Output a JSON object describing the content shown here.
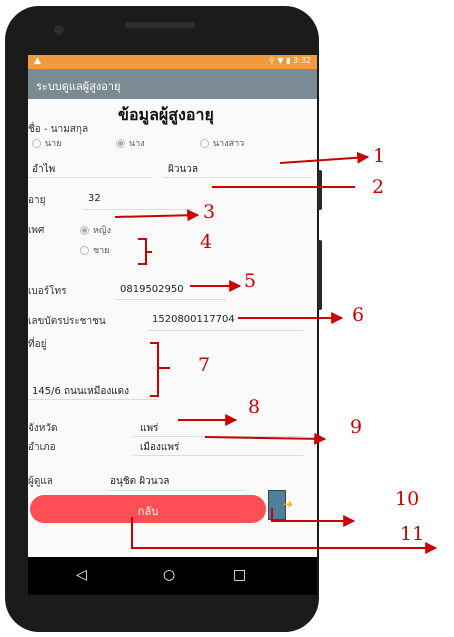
{
  "status_bar": {
    "warning_icon": "warning-icon",
    "indicators": "⚲ ▼ ▮",
    "time": "3:32",
    "color": "#f09a3c"
  },
  "app_bar": {
    "title": "ระบบดูแลผู้สูงอายุ",
    "color": "#7b8a93"
  },
  "page": {
    "title": "ข้อมูลผู้สูงอายุ"
  },
  "name_section": {
    "label": "ชื่อ - นามสกุล",
    "prefix_options": [
      "นาย",
      "นาง",
      "นางสาว"
    ],
    "selected_prefix": "นาง",
    "first_name": "อำไพ",
    "last_name": "ผิวนวล"
  },
  "age": {
    "label": "อายุ",
    "value": "32"
  },
  "gender": {
    "label": "เพศ",
    "options": [
      "หญิง",
      "ชาย"
    ],
    "selected": "หญิง"
  },
  "phone": {
    "label": "เบอร์โทร",
    "value": "0819502950"
  },
  "id_card": {
    "label": "เลขบัตรประชาชน",
    "value": "1520800117704"
  },
  "address": {
    "label": "ที่อยู่",
    "value": "145/6 ถนนเหมืองแดง"
  },
  "province": {
    "label": "จังหวัด",
    "value": "แพร่"
  },
  "district": {
    "label": "อำเภอ",
    "value": "เมืองแพร่"
  },
  "caretaker": {
    "label": "ผู้ดูแล",
    "value": "อนุชิต ผิวนวล"
  },
  "back_button": {
    "label": "กลับ",
    "color": "#ff4f55"
  },
  "exit_icon": "exit-door-icon",
  "navbar": {
    "back": "◁",
    "home": "○",
    "recent": "□"
  },
  "annotations": {
    "color": "#cc0000",
    "numbers": [
      "1",
      "2",
      "3",
      "4",
      "5",
      "6",
      "7",
      "8",
      "9",
      "10",
      "11"
    ]
  }
}
